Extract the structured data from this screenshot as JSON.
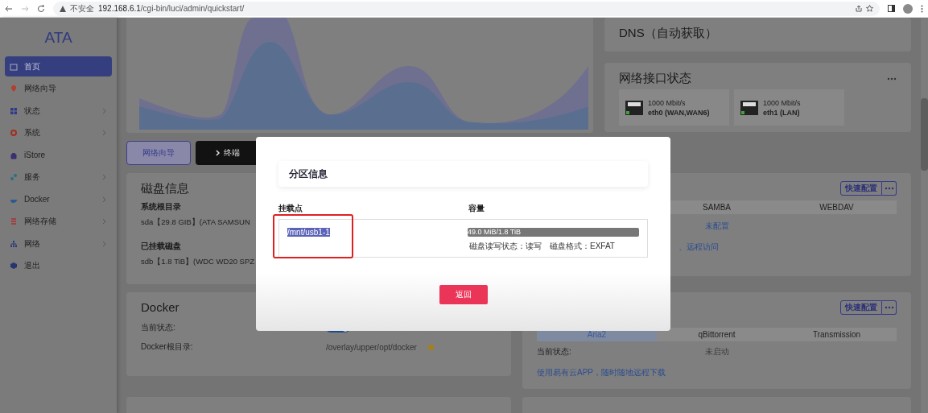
{
  "browser": {
    "security_label": "不安全",
    "url_host": "192.168.6.1",
    "url_path": "/cgi-bin/luci/admin/quickstart/"
  },
  "sidebar": {
    "logo": "ATA",
    "items": [
      {
        "label": "首页",
        "selected": true,
        "has_submenu": false
      },
      {
        "label": "网络向导",
        "selected": false,
        "has_submenu": false
      },
      {
        "label": "状态",
        "selected": false,
        "has_submenu": true
      },
      {
        "label": "系统",
        "selected": false,
        "has_submenu": true
      },
      {
        "label": "iStore",
        "selected": false,
        "has_submenu": false
      },
      {
        "label": "服务",
        "selected": false,
        "has_submenu": true
      },
      {
        "label": "Docker",
        "selected": false,
        "has_submenu": true
      },
      {
        "label": "网络存储",
        "selected": false,
        "has_submenu": true
      },
      {
        "label": "网络",
        "selected": false,
        "has_submenu": true
      },
      {
        "label": "退出",
        "selected": false,
        "has_submenu": false
      }
    ]
  },
  "quick_buttons": [
    {
      "label": "网络向导",
      "kind": "outline"
    },
    {
      "label": "终端",
      "kind": "terminal"
    }
  ],
  "dns_card": {
    "title": "DNS（自动获取）"
  },
  "network_card": {
    "title": "网络接口状态",
    "ports": [
      {
        "speed": "1000 Mbit/s",
        "name": "eth0 (WAN,WAN6)",
        "link_up": true
      },
      {
        "speed": "1000 Mbit/s",
        "name": "eth1 (LAN)",
        "link_up": true
      }
    ]
  },
  "disk_card": {
    "title": "磁盘信息",
    "sections": [
      {
        "label": "系统根目录",
        "value": "sda【29.8 GIB】(ATA SAMSUN"
      },
      {
        "label": "已挂载磁盘",
        "value": "sdb【1.8 TiB】(WDC WD20 SPZ"
      }
    ]
  },
  "storage_card": {
    "config_button": "快速配置",
    "tabs": [
      {
        "label": "SAMBA"
      },
      {
        "label": "WEBDAV"
      }
    ],
    "status_link": "未配置",
    "remote_link": "、远程访问"
  },
  "docker_card": {
    "title": "Docker",
    "status_label": "当前状态:",
    "enabled": true,
    "dir_label": "Docker根目录:",
    "dir_value": "/overlay/upper/opt/docker"
  },
  "download_card": {
    "config_button": "快速配置",
    "tabs": [
      {
        "label": "Aria2",
        "selected": true
      },
      {
        "label": "qBittorrent",
        "selected": false
      },
      {
        "label": "Transmission",
        "selected": false
      }
    ],
    "status_label": "当前状态:",
    "status_value": "未启动",
    "app_link": "使用易有云APP，随时随地远程下载"
  },
  "modal": {
    "title": "分区信息",
    "columns": [
      "挂载点",
      "容量"
    ],
    "rows": [
      {
        "mount": "/mnt/usb1-1",
        "highlighted": true,
        "usage": "49.0 MiB/1.8 TiB",
        "rw_status": "磁盘读写状态：读写",
        "format": "磁盘格式：EXFAT"
      }
    ],
    "back_button": "返回"
  }
}
